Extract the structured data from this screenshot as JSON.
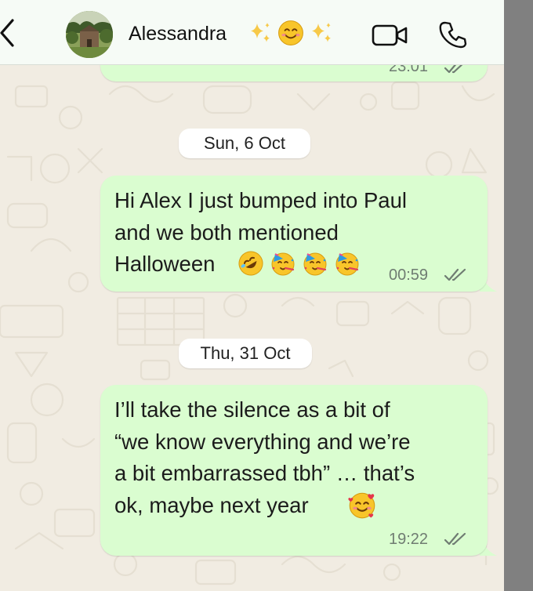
{
  "header": {
    "contact_name": "Alessandra",
    "name_emojis": [
      "sparkles",
      "smiling-face",
      "sparkles"
    ],
    "back_icon": "chevron-left-icon",
    "video_icon": "video-camera-icon",
    "call_icon": "phone-icon"
  },
  "messages": [
    {
      "date_label": "",
      "time": "23:01",
      "partial": true
    },
    {
      "date_label": "Sun, 6 Oct",
      "text_lines": [
        "Hi Alex I just bumped into Paul",
        "and we both mentioned",
        "Halloween"
      ],
      "emojis": [
        "rolling-on-floor-laughing",
        "partying-face",
        "partying-face",
        "partying-face"
      ],
      "time": "00:59",
      "status": "read"
    },
    {
      "date_label": "Thu, 31 Oct",
      "text_lines": [
        "I’ll take the silence as a bit of",
        "“we know everything and we’re",
        "a bit embarrassed tbh” … that’s",
        "ok, maybe next year"
      ],
      "emojis": [
        "smiling-face-with-hearts"
      ],
      "time": "19:22",
      "status": "read"
    }
  ],
  "colors": {
    "outgoing_bubble": "#dafdd0",
    "chat_background": "#f1ece2",
    "header_background": "#f6fbf6",
    "date_pill": "#ffffff",
    "side_strip": "#808080"
  }
}
